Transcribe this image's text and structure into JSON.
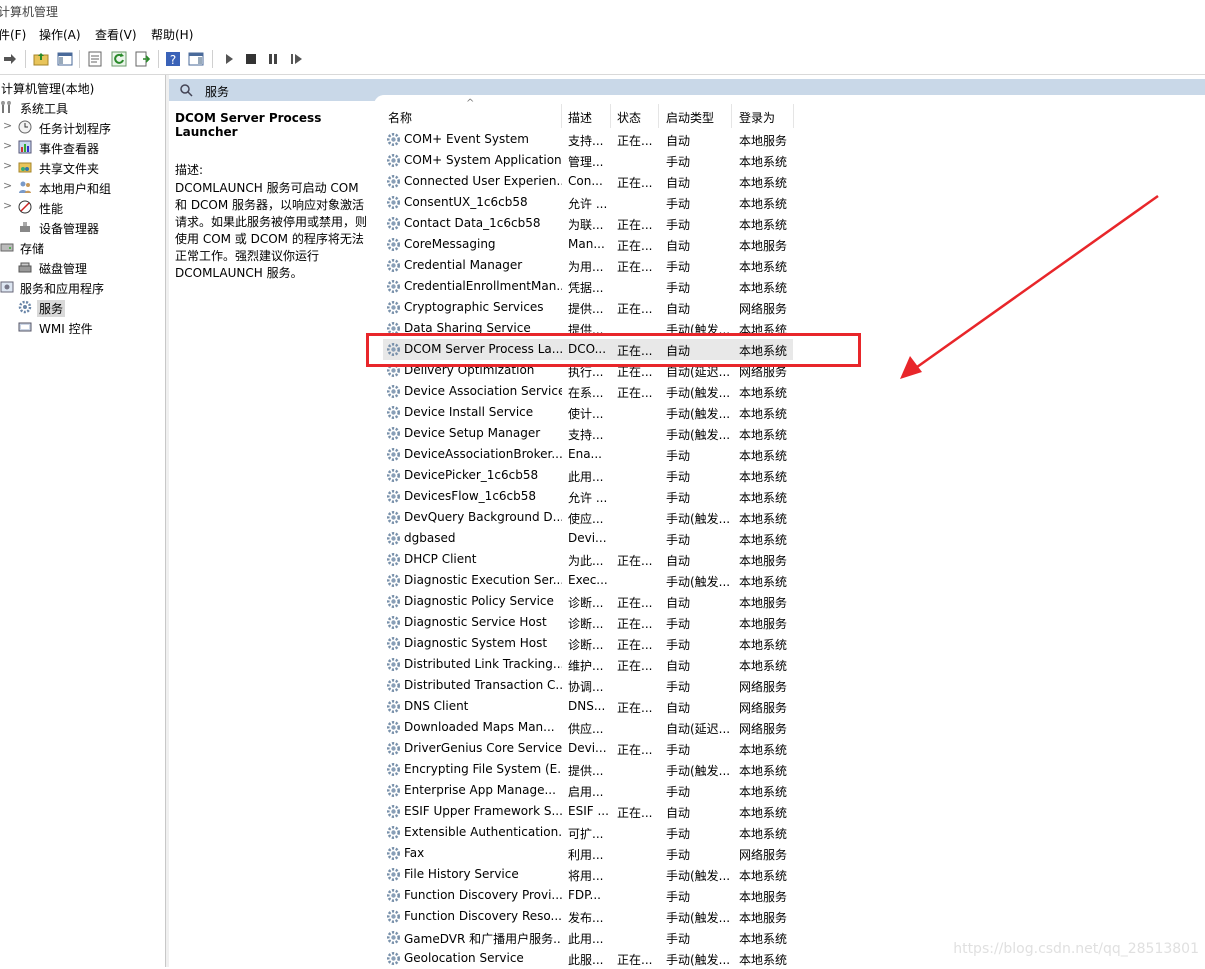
{
  "window": {
    "title": "计算机管理"
  },
  "menu": {
    "file": "件(F)",
    "action": "操作(A)",
    "view": "查看(V)",
    "help": "帮助(H)"
  },
  "tree": {
    "root": "计算机管理(本地)",
    "system_tools": "系统工具",
    "task_scheduler": "任务计划程序",
    "event_viewer": "事件查看器",
    "shared_folders": "共享文件夹",
    "local_users": "本地用户和组",
    "performance": "性能",
    "device_manager": "设备管理器",
    "storage": "存储",
    "disk_management": "磁盘管理",
    "services_apps": "服务和应用程序",
    "services": "服务",
    "wmi": "WMI 控件"
  },
  "header": {
    "title": "服务"
  },
  "description": {
    "service_name": "DCOM Server Process Launcher",
    "label": "描述:",
    "text": "DCOMLAUNCH 服务可启动 COM 和 DCOM 服务器，以响应对象激活请求。如果此服务被停用或禁用，则使用 COM 或 DCOM 的程序将无法正常工作。强烈建议你运行 DCOMLAUNCH 服务。"
  },
  "columns": {
    "name": "名称",
    "desc": "描述",
    "status": "状态",
    "startup": "启动类型",
    "logon": "登录为"
  },
  "services": [
    {
      "name": "COM+ Event System",
      "desc": "支持...",
      "status": "正在...",
      "startup": "自动",
      "logon": "本地服务"
    },
    {
      "name": "COM+ System Application",
      "desc": "管理...",
      "status": "",
      "startup": "手动",
      "logon": "本地系统"
    },
    {
      "name": "Connected User Experien...",
      "desc": "Con...",
      "status": "正在...",
      "startup": "自动",
      "logon": "本地系统"
    },
    {
      "name": "ConsentUX_1c6cb58",
      "desc": "允许 ...",
      "status": "",
      "startup": "手动",
      "logon": "本地系统"
    },
    {
      "name": "Contact Data_1c6cb58",
      "desc": "为联...",
      "status": "正在...",
      "startup": "手动",
      "logon": "本地系统"
    },
    {
      "name": "CoreMessaging",
      "desc": "Man...",
      "status": "正在...",
      "startup": "自动",
      "logon": "本地服务"
    },
    {
      "name": "Credential Manager",
      "desc": "为用...",
      "status": "正在...",
      "startup": "手动",
      "logon": "本地系统"
    },
    {
      "name": "CredentialEnrollmentMan...",
      "desc": "凭据...",
      "status": "",
      "startup": "手动",
      "logon": "本地系统"
    },
    {
      "name": "Cryptographic Services",
      "desc": "提供...",
      "status": "正在...",
      "startup": "自动",
      "logon": "网络服务"
    },
    {
      "name": "Data Sharing Service",
      "desc": "提供...",
      "status": "",
      "startup": "手动(触发...",
      "logon": "本地系统"
    },
    {
      "name": "DCOM Server Process La...",
      "desc": "DCO...",
      "status": "正在...",
      "startup": "自动",
      "logon": "本地系统"
    },
    {
      "name": "Delivery Optimization",
      "desc": "执行...",
      "status": "正在...",
      "startup": "自动(延迟...",
      "logon": "网络服务"
    },
    {
      "name": "Device Association Service",
      "desc": "在系...",
      "status": "正在...",
      "startup": "手动(触发...",
      "logon": "本地系统"
    },
    {
      "name": "Device Install Service",
      "desc": "使计...",
      "status": "",
      "startup": "手动(触发...",
      "logon": "本地系统"
    },
    {
      "name": "Device Setup Manager",
      "desc": "支持...",
      "status": "",
      "startup": "手动(触发...",
      "logon": "本地系统"
    },
    {
      "name": "DeviceAssociationBroker...",
      "desc": "Ena...",
      "status": "",
      "startup": "手动",
      "logon": "本地系统"
    },
    {
      "name": "DevicePicker_1c6cb58",
      "desc": "此用...",
      "status": "",
      "startup": "手动",
      "logon": "本地系统"
    },
    {
      "name": "DevicesFlow_1c6cb58",
      "desc": "允许 ...",
      "status": "",
      "startup": "手动",
      "logon": "本地系统"
    },
    {
      "name": "DevQuery Background D...",
      "desc": "使应...",
      "status": "",
      "startup": "手动(触发...",
      "logon": "本地系统"
    },
    {
      "name": "dgbased",
      "desc": "Devi...",
      "status": "",
      "startup": "手动",
      "logon": "本地系统"
    },
    {
      "name": "DHCP Client",
      "desc": "为此...",
      "status": "正在...",
      "startup": "自动",
      "logon": "本地服务"
    },
    {
      "name": "Diagnostic Execution Ser...",
      "desc": "Exec...",
      "status": "",
      "startup": "手动(触发...",
      "logon": "本地系统"
    },
    {
      "name": "Diagnostic Policy Service",
      "desc": "诊断...",
      "status": "正在...",
      "startup": "自动",
      "logon": "本地服务"
    },
    {
      "name": "Diagnostic Service Host",
      "desc": "诊断...",
      "status": "正在...",
      "startup": "手动",
      "logon": "本地服务"
    },
    {
      "name": "Diagnostic System Host",
      "desc": "诊断...",
      "status": "正在...",
      "startup": "手动",
      "logon": "本地系统"
    },
    {
      "name": "Distributed Link Tracking...",
      "desc": "维护...",
      "status": "正在...",
      "startup": "自动",
      "logon": "本地系统"
    },
    {
      "name": "Distributed Transaction C...",
      "desc": "协调...",
      "status": "",
      "startup": "手动",
      "logon": "网络服务"
    },
    {
      "name": "DNS Client",
      "desc": "DNS...",
      "status": "正在...",
      "startup": "自动",
      "logon": "网络服务"
    },
    {
      "name": "Downloaded Maps Man...",
      "desc": "供应...",
      "status": "",
      "startup": "自动(延迟...",
      "logon": "网络服务"
    },
    {
      "name": "DriverGenius Core Service",
      "desc": "Devi...",
      "status": "正在...",
      "startup": "手动",
      "logon": "本地系统"
    },
    {
      "name": "Encrypting File System (E...",
      "desc": "提供...",
      "status": "",
      "startup": "手动(触发...",
      "logon": "本地系统"
    },
    {
      "name": "Enterprise App Manage...",
      "desc": "启用...",
      "status": "",
      "startup": "手动",
      "logon": "本地系统"
    },
    {
      "name": "ESIF Upper Framework S...",
      "desc": "ESIF ...",
      "status": "正在...",
      "startup": "自动",
      "logon": "本地系统"
    },
    {
      "name": "Extensible Authentication...",
      "desc": "可扩...",
      "status": "",
      "startup": "手动",
      "logon": "本地系统"
    },
    {
      "name": "Fax",
      "desc": "利用...",
      "status": "",
      "startup": "手动",
      "logon": "网络服务"
    },
    {
      "name": "File History Service",
      "desc": "将用...",
      "status": "",
      "startup": "手动(触发...",
      "logon": "本地系统"
    },
    {
      "name": "Function Discovery Provi...",
      "desc": "FDP...",
      "status": "",
      "startup": "手动",
      "logon": "本地服务"
    },
    {
      "name": "Function Discovery Reso...",
      "desc": "发布...",
      "status": "",
      "startup": "手动(触发...",
      "logon": "本地服务"
    },
    {
      "name": "GameDVR 和广播用户服务...",
      "desc": "此用...",
      "status": "",
      "startup": "手动",
      "logon": "本地系统"
    },
    {
      "name": "Geolocation Service",
      "desc": "此服...",
      "status": "正在...",
      "startup": "手动(触发...",
      "logon": "本地系统"
    }
  ],
  "watermark": "https://blog.csdn.net/qq_28513801",
  "colors": {
    "highlight": "#e8262a",
    "header_band": "#c9d8e8",
    "selected_row": "#e8e8e8"
  }
}
